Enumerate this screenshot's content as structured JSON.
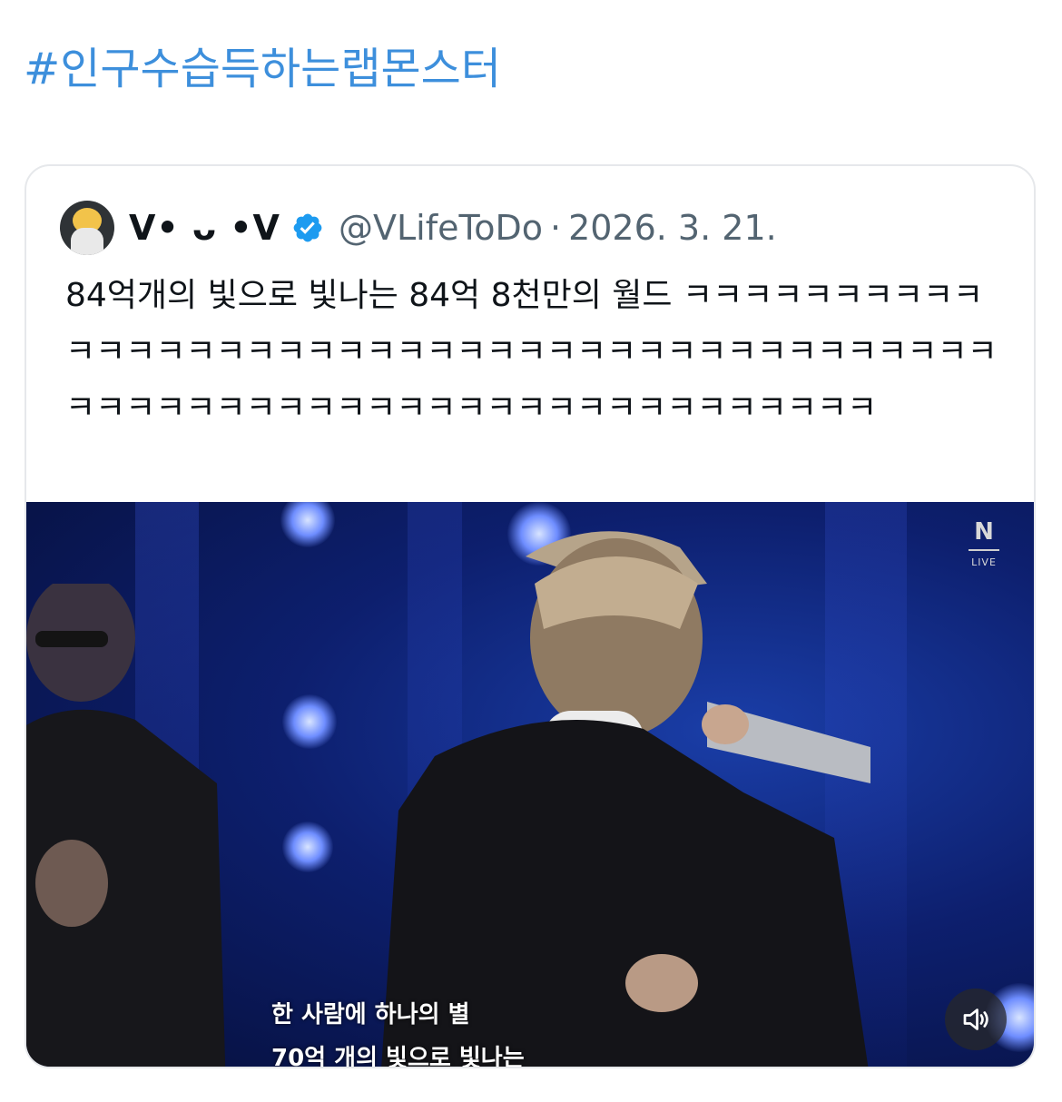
{
  "tweet": {
    "hashtag": "#인구수습득하는랩몬스터"
  },
  "quoted_tweet": {
    "display_name": "V• ᴗ •V",
    "handle": "@VLifeToDo",
    "separator": "·",
    "date": "2026. 3. 21.",
    "text": "84억개의 빛으로 빛나는 84억 8천만의 월드 ㅋㅋㅋㅋㅋㅋㅋㅋㅋㅋㅋㅋㅋㅋㅋㅋㅋㅋㅋㅋㅋㅋㅋㅋㅋㅋㅋㅋㅋㅋㅋㅋㅋㅋㅋㅋㅋㅋㅋㅋㅋㅋㅋㅋㅋㅋㅋㅋㅋㅋㅋㅋㅋㅋㅋㅋㅋㅋㅋㅋㅋㅋㅋㅋㅋㅋㅋㅋ",
    "verified": true,
    "media": {
      "logo_letter": "N",
      "logo_sub": "LIVE",
      "subtitle_line1": "한 사람에 하나의 별",
      "subtitle_line2": "70억 개의 빛으로 빛나는",
      "mute_icon": "speaker-muted-icon"
    }
  },
  "colors": {
    "link": "#3d8fdc",
    "verified": "#1d9bf0",
    "text_primary": "#0f1419",
    "text_secondary": "#536471",
    "card_border": "#e6e8eb"
  }
}
